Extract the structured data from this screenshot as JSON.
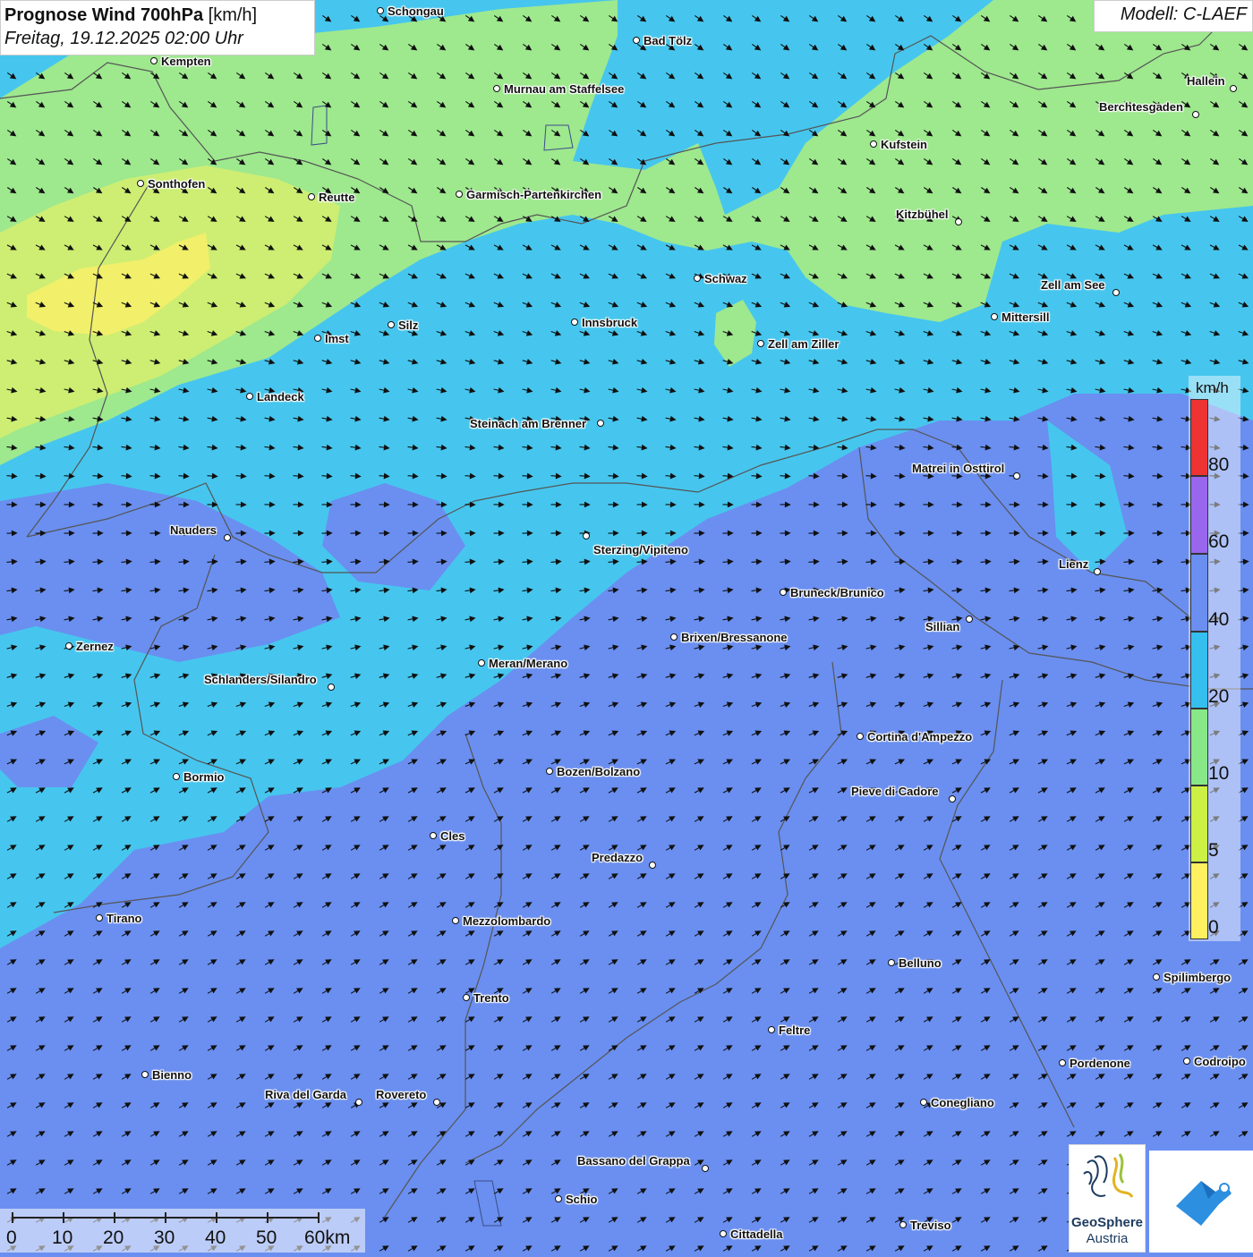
{
  "title": {
    "bold": "Prognose Wind 700hPa",
    "unit": "[km/h]",
    "time": "Freitag, 19.12.2025 02:00 Uhr"
  },
  "model": "Modell: C-LAEF",
  "legend": {
    "unit": "km/h",
    "ticks": [
      "80",
      "60",
      "40",
      "20",
      "10",
      "5",
      "0"
    ],
    "colors": [
      "#ee3333",
      "#9966ee",
      "#6a8ff0",
      "#35bfee",
      "#88e888",
      "#ccf044",
      "#fff060"
    ]
  },
  "scale_bar": {
    "labels": [
      "0",
      "10",
      "20",
      "30",
      "40",
      "50",
      "60km"
    ]
  },
  "map_colors": {
    "band_0_5": "#f2ef6a",
    "band_5_10": "#cdee72",
    "band_10_20": "#9ee88e",
    "band_20_40": "#46c6ee",
    "band_40_60": "#6a8ff0",
    "arrow": "#111111",
    "border": "#555555"
  },
  "wind_direction": "from west-southwest (arrows pointing east-northeast in south, east-southeast in north)",
  "cities": [
    {
      "name": "Schongau"
    },
    {
      "name": "Kempten"
    },
    {
      "name": "Bad Tölz"
    },
    {
      "name": "Murnau am Staffelsee"
    },
    {
      "name": "Hallein"
    },
    {
      "name": "Berchtesgaden"
    },
    {
      "name": "Kufstein"
    },
    {
      "name": "Sonthofen"
    },
    {
      "name": "Reutte"
    },
    {
      "name": "Garmisch-Partenkirchen"
    },
    {
      "name": "Kitzbühel"
    },
    {
      "name": "Schwaz"
    },
    {
      "name": "Zell am See"
    },
    {
      "name": "Mittersill"
    },
    {
      "name": "Innsbruck"
    },
    {
      "name": "Silz"
    },
    {
      "name": "Imst"
    },
    {
      "name": "Zell am Ziller"
    },
    {
      "name": "Landeck"
    },
    {
      "name": "Steinach am Brenner"
    },
    {
      "name": "Matrei in Osttirol"
    },
    {
      "name": "Nauders"
    },
    {
      "name": "Sterzing/Vipiteno"
    },
    {
      "name": "Lienz"
    },
    {
      "name": "Bruneck/Brunico"
    },
    {
      "name": "Sillian"
    },
    {
      "name": "Brixen/Bressanone"
    },
    {
      "name": "Zernez"
    },
    {
      "name": "Meran/Merano"
    },
    {
      "name": "Schlanders/Silandro"
    },
    {
      "name": "Cortina d'Ampezzo"
    },
    {
      "name": "Bozen/Bolzano"
    },
    {
      "name": "Bormio"
    },
    {
      "name": "Pieve di Cadore"
    },
    {
      "name": "Cles"
    },
    {
      "name": "Predazzo"
    },
    {
      "name": "Tirano"
    },
    {
      "name": "Mezzolombardo"
    },
    {
      "name": "Belluno"
    },
    {
      "name": "Spilimbergo"
    },
    {
      "name": "Trento"
    },
    {
      "name": "Feltre"
    },
    {
      "name": "Pordenone"
    },
    {
      "name": "Codroipo"
    },
    {
      "name": "Bienno"
    },
    {
      "name": "Riva del Garda"
    },
    {
      "name": "Rovereto"
    },
    {
      "name": "Conegliano"
    },
    {
      "name": "Bassano del Grappa"
    },
    {
      "name": "Schio"
    },
    {
      "name": "Treviso"
    },
    {
      "name": "Cittadella"
    }
  ],
  "logos": {
    "geosphere_name": "GeoSphere",
    "geosphere_country": "Austria"
  }
}
